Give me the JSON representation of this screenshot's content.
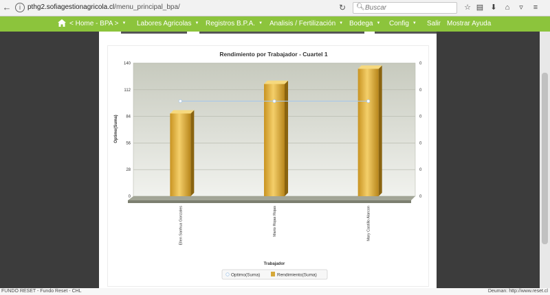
{
  "browser": {
    "url_host": "pthg2.sofiagestionagricola.cl",
    "url_path": "/menu_principal_bpa/",
    "search_placeholder": "Buscar"
  },
  "nav": {
    "items": [
      {
        "label": "< Home -  BPA  >",
        "caret": true
      },
      {
        "label": "Labores Agricolas",
        "caret": true
      },
      {
        "label": "Registros B.P.A.",
        "caret": true
      },
      {
        "label": "Analisis / Fertilización",
        "caret": true
      },
      {
        "label": "Bodega",
        "caret": true
      },
      {
        "label": "Config",
        "caret": true
      },
      {
        "label": "Salir",
        "caret": false
      },
      {
        "label": "Mostrar Ayuda",
        "caret": false
      }
    ]
  },
  "chart_data": {
    "type": "bar",
    "title": "Rendimiento por Trabajador - Cuartel 1",
    "xlabel": "Trabajador",
    "ylabel": "Optimo(Suma)",
    "categories": [
      "Ellen Sanhua Gonzales",
      "Mario Rojas Rojas",
      "Mary Castillo Alarcon"
    ],
    "ylim": [
      0,
      140
    ],
    "yticks": [
      0,
      28,
      56,
      84,
      112,
      140
    ],
    "y2ticks": [
      "0",
      "0",
      "0",
      "0",
      "0",
      "0"
    ],
    "series": [
      {
        "name": "Optimo(Suma)",
        "kind": "line",
        "values": [
          100,
          100,
          100
        ],
        "color": "#a9c8e8"
      },
      {
        "name": "Rendimiento(Suma)",
        "kind": "bar",
        "values": [
          87,
          118,
          134
        ],
        "color": "#d6a93a"
      }
    ],
    "legend": "bottom"
  },
  "status": {
    "left": "FUNDO RESET - Fundo Reset - CHL",
    "right": "Deuman: http://www.reset.cl"
  },
  "colors": {
    "nav_green": "#8cc43c",
    "bar_gold": "#d6a93a"
  }
}
